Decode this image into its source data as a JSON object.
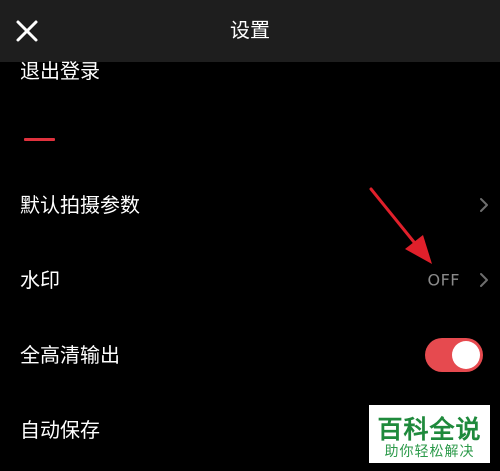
{
  "header": {
    "title": "设置"
  },
  "settings": {
    "logout_label": "退出登录",
    "items": [
      {
        "label": "默认拍摄参数"
      },
      {
        "label": "水印",
        "value": "OFF"
      },
      {
        "label": "全高清输出",
        "toggle_on": true
      },
      {
        "label": "自动保存"
      }
    ]
  },
  "colors": {
    "accent": "#e0323e",
    "toggle_on": "#e64a4f",
    "arrow": "#e0202b",
    "header_bg": "#1e1e1e"
  },
  "watermark": {
    "title": "百科全说",
    "subtitle": "助你轻松解决"
  }
}
